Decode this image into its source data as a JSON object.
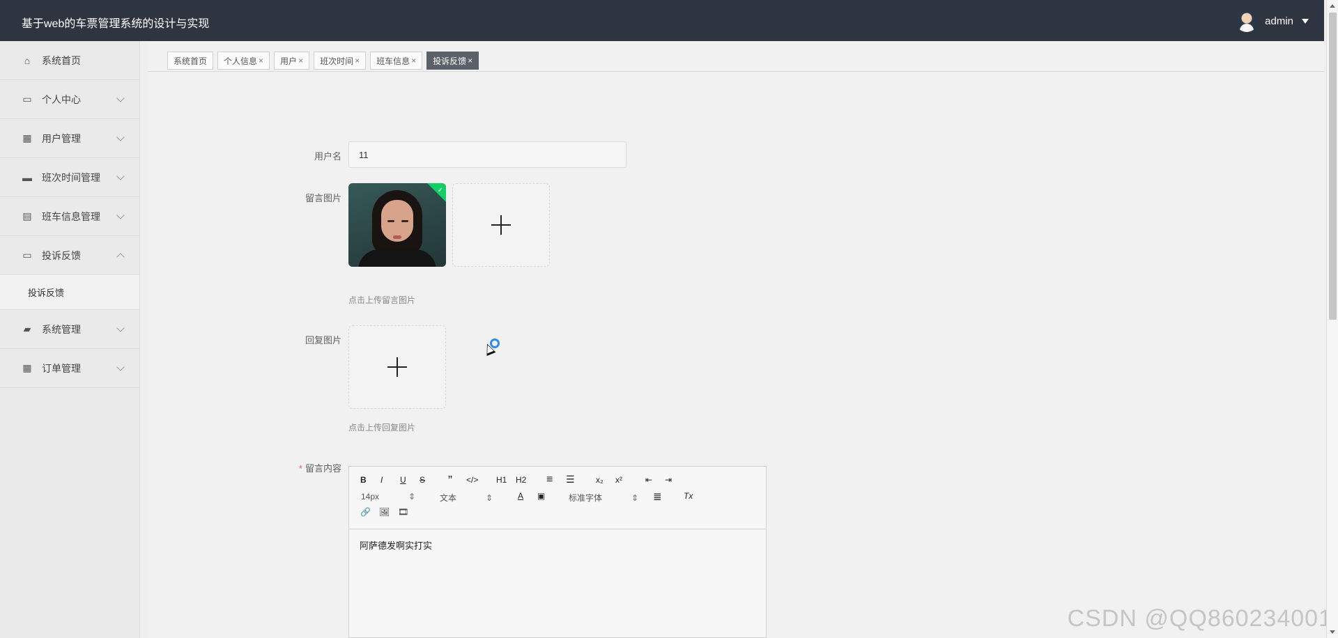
{
  "app": {
    "title": "基于web的车票管理系统的设计与实现",
    "user": "admin"
  },
  "sidebar": {
    "items": [
      {
        "label": "系统首页",
        "icon": "home-icon",
        "expandable": false
      },
      {
        "label": "个人中心",
        "icon": "profile-icon",
        "expandable": true
      },
      {
        "label": "用户管理",
        "icon": "grid-icon",
        "expandable": true
      },
      {
        "label": "班次时间管理",
        "icon": "briefcase-icon",
        "expandable": true
      },
      {
        "label": "班车信息管理",
        "icon": "clipboard-icon",
        "expandable": true
      },
      {
        "label": "投诉反馈",
        "icon": "monitor-icon",
        "expandable": true,
        "expanded": true
      },
      {
        "label": "系统管理",
        "icon": "chat-icon",
        "expandable": true
      },
      {
        "label": "订单管理",
        "icon": "grid-icon",
        "expandable": true
      }
    ],
    "submenu": {
      "label": "投诉反馈"
    }
  },
  "tabs": [
    {
      "label": "系统首页",
      "closable": false,
      "active": false
    },
    {
      "label": "个人信息",
      "closable": true,
      "active": false
    },
    {
      "label": "用户",
      "closable": true,
      "active": false
    },
    {
      "label": "班次时间",
      "closable": true,
      "active": false
    },
    {
      "label": "班车信息",
      "closable": true,
      "active": false
    },
    {
      "label": "投诉反馈",
      "closable": true,
      "active": true
    }
  ],
  "close_symbol": "×",
  "form": {
    "username_label": "用户名",
    "username_value": "11",
    "message_image_label": "留言图片",
    "message_image_tip": "点击上传留言图片",
    "reply_image_label": "回复图片",
    "reply_image_tip": "点击上传回复图片",
    "message_content_label": "留言内容",
    "required_mark": "*"
  },
  "editor": {
    "font_size": "14px",
    "paragraph": "文本",
    "font_family": "标准字体",
    "content": "阿萨德发啊实打实",
    "toolbar_tools": [
      {
        "label": "B"
      },
      {
        "label": "I"
      },
      {
        "label": "U"
      },
      {
        "label": "S"
      },
      {
        "label": "”"
      },
      {
        "label": "</>"
      },
      {
        "label": "H1"
      },
      {
        "label": "H2"
      },
      {
        "label": "≡"
      },
      {
        "label": "☰"
      },
      {
        "label": "x₂"
      },
      {
        "label": "x²"
      },
      {
        "label": "⇤"
      },
      {
        "label": "⇥"
      },
      {
        "label": "A"
      },
      {
        "label": "▣"
      },
      {
        "label": "≣"
      },
      {
        "label": "Tx"
      },
      {
        "label": "🔗"
      },
      {
        "label": "🖼"
      },
      {
        "label": "🎞"
      }
    ]
  },
  "watermark": "CSDN @QQ860234001"
}
